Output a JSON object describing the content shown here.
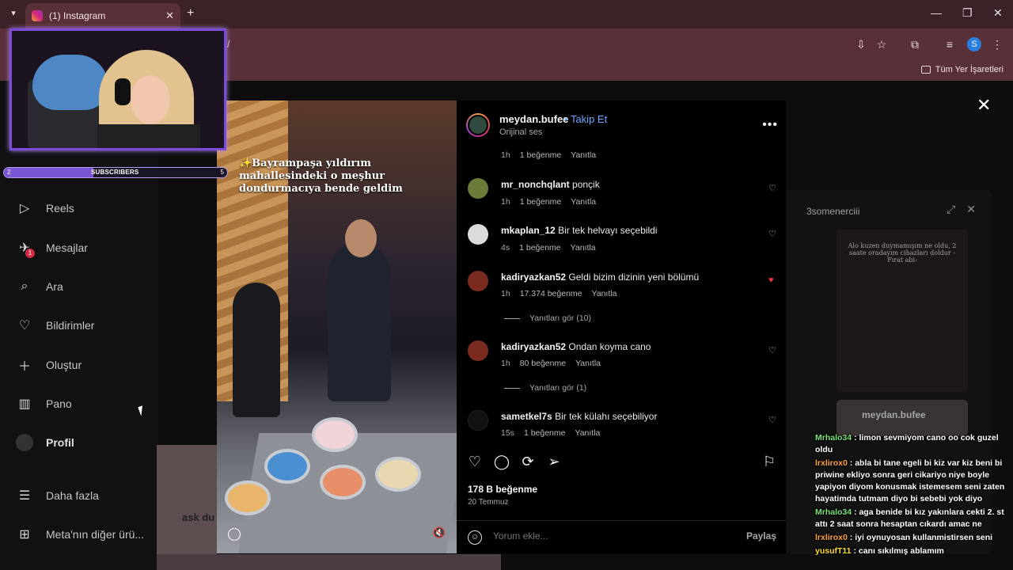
{
  "browser": {
    "tab_title": "(1) Instagram",
    "url_fragment": "/",
    "bookmarks_label": "Tüm Yer İşaretleri",
    "profile_initial": "S"
  },
  "sidebar": {
    "items": [
      {
        "label": "Reels",
        "icon": "reels-icon"
      },
      {
        "label": "Mesajlar",
        "icon": "messages-icon",
        "badge": "1"
      },
      {
        "label": "Ara",
        "icon": "search-icon"
      },
      {
        "label": "Bildirimler",
        "icon": "heart-icon"
      },
      {
        "label": "Oluştur",
        "icon": "plus-icon"
      },
      {
        "label": "Pano",
        "icon": "dashboard-icon"
      },
      {
        "label": "Profil",
        "icon": "profile-avatar"
      },
      {
        "label": "Daha fazla",
        "icon": "menu-icon"
      },
      {
        "label": "Meta'nın diğer ürü...",
        "icon": "apps-icon"
      }
    ]
  },
  "background_label": "ask du",
  "video": {
    "caption": "✨Bayrampaşa yıldırım mahallesindeki o meşhur dondurmacıya bende geldim"
  },
  "post": {
    "username": "meydan.bufee",
    "follow_label": "Takip Et",
    "separator": "•",
    "audio": "Orijinal ses",
    "top_meta": {
      "time": "1h",
      "likes": "1 beğenme",
      "reply": "Yanıtla"
    },
    "comments": [
      {
        "user": "mr_nonchqlant",
        "text": "ponçik",
        "time": "1h",
        "likes": "1 beğenme",
        "reply": "Yanıtla",
        "liked": false
      },
      {
        "user": "mkaplan_12",
        "text": "Bir tek helvayı seçebildi",
        "time": "4s",
        "likes": "1 beğenme",
        "reply": "Yanıtla",
        "liked": false
      },
      {
        "user": "kadiryazkan52",
        "text": "Geldi bizim dizinin yeni bölümü",
        "time": "1h",
        "likes": "17.374 beğenme",
        "reply": "Yanıtla",
        "liked": true,
        "replies": "Yanıtları gör (10)"
      },
      {
        "user": "kadiryazkan52",
        "text": "Ondan koyma cano",
        "time": "1h",
        "likes": "80 beğenme",
        "reply": "Yanıtla",
        "liked": false,
        "replies": "Yanıtları gör (1)"
      },
      {
        "user": "sametkel7s",
        "text": "Bir tek külahı seçebiliyor",
        "time": "15s",
        "likes": "1 beğenme",
        "reply": "Yanıtla",
        "liked": false
      }
    ],
    "likes_total": "178 B beğenme",
    "date": "20 Temmuz",
    "comment_placeholder": "Yorum ekle...",
    "share_label": "Paylaş"
  },
  "right_panel": {
    "username": "3somenerciii",
    "video_text": "Alo kuzen duymamışım ne oldu, 2 saate oradayım cihazları doldur -Fırat abi-",
    "card_name": "meydan.bufee"
  },
  "chat": [
    {
      "name": "Mrhalo34",
      "color": "#7be07b",
      "text": ": limon sevmiyom cano oo cok guzel oldu"
    },
    {
      "name": "lrxlirox0",
      "color": "#ffa341",
      "text": ": abla bi tane egeli bi kiz var kiz beni bi priwine ekliyo sonra geri cikariyo niye boyle yapiyon diyom konusmak istemesem seni zaten hayatimda tutmam diyo bi sebebi yok diyo"
    },
    {
      "name": "Mrhalo34",
      "color": "#7be07b",
      "text": ": aga benide bi kız yakınlara cekti 2. st attı 2 saat sonra hesaptan cıkardı amac ne"
    },
    {
      "name": "lrxlirox0",
      "color": "#ffa341",
      "text": ": iyi oynuyosan kullanmistirsen seni"
    },
    {
      "name": "yusufT11",
      "color": "#ffd93b",
      "text": ": canı sıkılmış ablamım"
    }
  ],
  "overlay": {
    "sub_label": "SUBSCRIBERS",
    "sub_start": "2",
    "sub_end": "5",
    "sub_progress": 0.4
  }
}
